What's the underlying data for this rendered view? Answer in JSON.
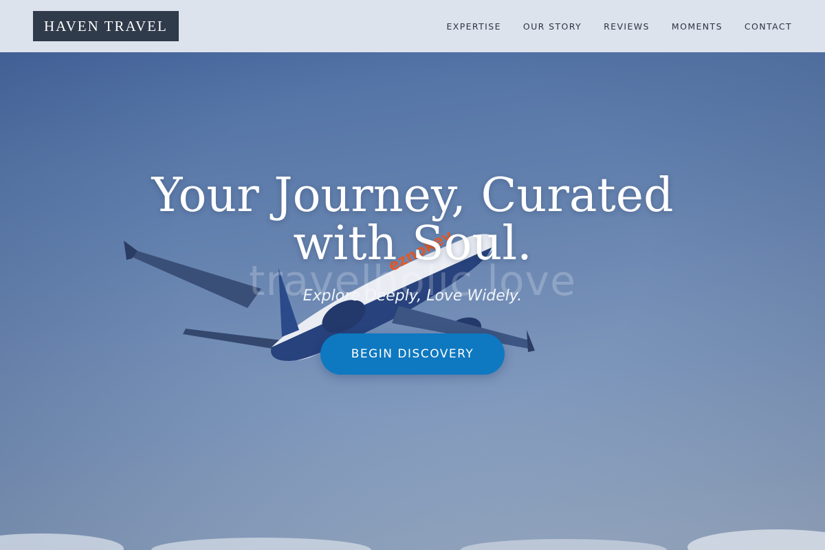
{
  "brand": {
    "name": "HAVEN TRAVEL"
  },
  "nav": {
    "items": [
      {
        "label": "EXPERTISE"
      },
      {
        "label": "OUR STORY"
      },
      {
        "label": "REVIEWS"
      },
      {
        "label": "MOMENTS"
      },
      {
        "label": "CONTACT"
      }
    ]
  },
  "hero": {
    "title_line1": "Your Journey, Curated",
    "title_line2": "with Soul.",
    "watermark": "travelholic love",
    "subtitle": "Explore Deeply, Love Widely.",
    "cta_label": "BEGIN DISCOVERY",
    "plane_livery": "eznokey"
  },
  "colors": {
    "header_bg": "#e2e7f0",
    "logo_bg": "#2f3a4a",
    "cta_bg": "#0e78c0",
    "sky_top": "#40609a",
    "sky_bottom": "#a9b8cc"
  }
}
